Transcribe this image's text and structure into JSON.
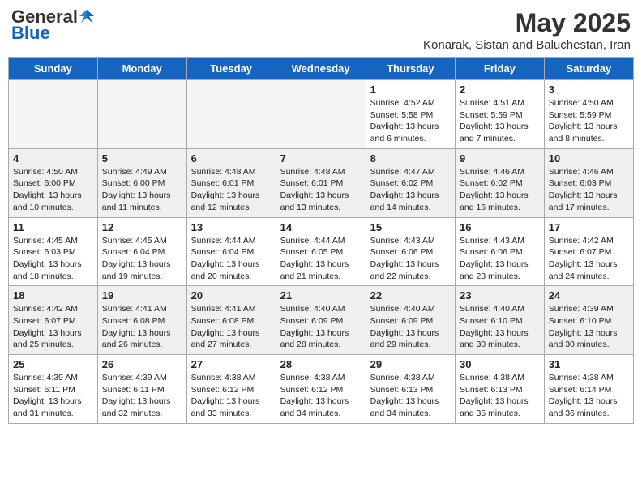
{
  "header": {
    "logo_general": "General",
    "logo_blue": "Blue",
    "title": "May 2025",
    "subtitle": "Konarak, Sistan and Baluchestan, Iran"
  },
  "weekdays": [
    "Sunday",
    "Monday",
    "Tuesday",
    "Wednesday",
    "Thursday",
    "Friday",
    "Saturday"
  ],
  "weeks": [
    [
      {
        "day": "",
        "info": ""
      },
      {
        "day": "",
        "info": ""
      },
      {
        "day": "",
        "info": ""
      },
      {
        "day": "",
        "info": ""
      },
      {
        "day": "1",
        "info": "Sunrise: 4:52 AM\nSunset: 5:58 PM\nDaylight: 13 hours and 6 minutes."
      },
      {
        "day": "2",
        "info": "Sunrise: 4:51 AM\nSunset: 5:59 PM\nDaylight: 13 hours and 7 minutes."
      },
      {
        "day": "3",
        "info": "Sunrise: 4:50 AM\nSunset: 5:59 PM\nDaylight: 13 hours and 8 minutes."
      }
    ],
    [
      {
        "day": "4",
        "info": "Sunrise: 4:50 AM\nSunset: 6:00 PM\nDaylight: 13 hours and 10 minutes."
      },
      {
        "day": "5",
        "info": "Sunrise: 4:49 AM\nSunset: 6:00 PM\nDaylight: 13 hours and 11 minutes."
      },
      {
        "day": "6",
        "info": "Sunrise: 4:48 AM\nSunset: 6:01 PM\nDaylight: 13 hours and 12 minutes."
      },
      {
        "day": "7",
        "info": "Sunrise: 4:48 AM\nSunset: 6:01 PM\nDaylight: 13 hours and 13 minutes."
      },
      {
        "day": "8",
        "info": "Sunrise: 4:47 AM\nSunset: 6:02 PM\nDaylight: 13 hours and 14 minutes."
      },
      {
        "day": "9",
        "info": "Sunrise: 4:46 AM\nSunset: 6:02 PM\nDaylight: 13 hours and 16 minutes."
      },
      {
        "day": "10",
        "info": "Sunrise: 4:46 AM\nSunset: 6:03 PM\nDaylight: 13 hours and 17 minutes."
      }
    ],
    [
      {
        "day": "11",
        "info": "Sunrise: 4:45 AM\nSunset: 6:03 PM\nDaylight: 13 hours and 18 minutes."
      },
      {
        "day": "12",
        "info": "Sunrise: 4:45 AM\nSunset: 6:04 PM\nDaylight: 13 hours and 19 minutes."
      },
      {
        "day": "13",
        "info": "Sunrise: 4:44 AM\nSunset: 6:04 PM\nDaylight: 13 hours and 20 minutes."
      },
      {
        "day": "14",
        "info": "Sunrise: 4:44 AM\nSunset: 6:05 PM\nDaylight: 13 hours and 21 minutes."
      },
      {
        "day": "15",
        "info": "Sunrise: 4:43 AM\nSunset: 6:06 PM\nDaylight: 13 hours and 22 minutes."
      },
      {
        "day": "16",
        "info": "Sunrise: 4:43 AM\nSunset: 6:06 PM\nDaylight: 13 hours and 23 minutes."
      },
      {
        "day": "17",
        "info": "Sunrise: 4:42 AM\nSunset: 6:07 PM\nDaylight: 13 hours and 24 minutes."
      }
    ],
    [
      {
        "day": "18",
        "info": "Sunrise: 4:42 AM\nSunset: 6:07 PM\nDaylight: 13 hours and 25 minutes."
      },
      {
        "day": "19",
        "info": "Sunrise: 4:41 AM\nSunset: 6:08 PM\nDaylight: 13 hours and 26 minutes."
      },
      {
        "day": "20",
        "info": "Sunrise: 4:41 AM\nSunset: 6:08 PM\nDaylight: 13 hours and 27 minutes."
      },
      {
        "day": "21",
        "info": "Sunrise: 4:40 AM\nSunset: 6:09 PM\nDaylight: 13 hours and 28 minutes."
      },
      {
        "day": "22",
        "info": "Sunrise: 4:40 AM\nSunset: 6:09 PM\nDaylight: 13 hours and 29 minutes."
      },
      {
        "day": "23",
        "info": "Sunrise: 4:40 AM\nSunset: 6:10 PM\nDaylight: 13 hours and 30 minutes."
      },
      {
        "day": "24",
        "info": "Sunrise: 4:39 AM\nSunset: 6:10 PM\nDaylight: 13 hours and 30 minutes."
      }
    ],
    [
      {
        "day": "25",
        "info": "Sunrise: 4:39 AM\nSunset: 6:11 PM\nDaylight: 13 hours and 31 minutes."
      },
      {
        "day": "26",
        "info": "Sunrise: 4:39 AM\nSunset: 6:11 PM\nDaylight: 13 hours and 32 minutes."
      },
      {
        "day": "27",
        "info": "Sunrise: 4:38 AM\nSunset: 6:12 PM\nDaylight: 13 hours and 33 minutes."
      },
      {
        "day": "28",
        "info": "Sunrise: 4:38 AM\nSunset: 6:12 PM\nDaylight: 13 hours and 34 minutes."
      },
      {
        "day": "29",
        "info": "Sunrise: 4:38 AM\nSunset: 6:13 PM\nDaylight: 13 hours and 34 minutes."
      },
      {
        "day": "30",
        "info": "Sunrise: 4:38 AM\nSunset: 6:13 PM\nDaylight: 13 hours and 35 minutes."
      },
      {
        "day": "31",
        "info": "Sunrise: 4:38 AM\nSunset: 6:14 PM\nDaylight: 13 hours and 36 minutes."
      }
    ]
  ]
}
